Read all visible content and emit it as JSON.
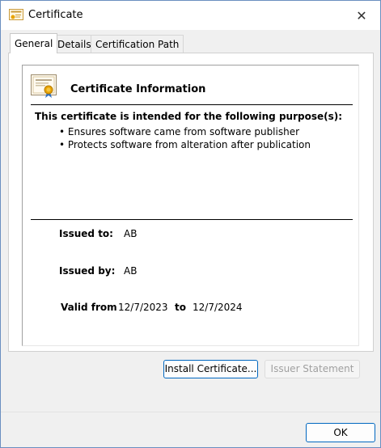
{
  "window": {
    "title": "Certificate",
    "close_glyph": "✕"
  },
  "tabs": [
    {
      "label": "General",
      "active": true
    },
    {
      "label": "Details",
      "active": false
    },
    {
      "label": "Certification Path",
      "active": false
    }
  ],
  "general": {
    "heading": "Certificate Information",
    "purpose_title": "This certificate is intended for the following purpose(s):",
    "purposes": [
      "Ensures software came from software publisher",
      "Protects software from alteration after publication"
    ],
    "issued_to_label": "Issued to:",
    "issued_to": "AB",
    "issued_by_label": "Issued by:",
    "issued_by": "AB",
    "valid_from_label": "Valid from",
    "valid_from": "12/7/2023",
    "valid_to_label": "to",
    "valid_to": "12/7/2024"
  },
  "buttons": {
    "install": "Install Certificate...",
    "issuer_statement": "Issuer Statement",
    "ok": "OK"
  },
  "colors": {
    "accent": "#0067c0",
    "disabled_text": "#a0a0a0",
    "seal": "#e8a300"
  },
  "icons": {
    "title": "certificate-icon",
    "info": "certificate-icon",
    "close": "close-icon"
  }
}
